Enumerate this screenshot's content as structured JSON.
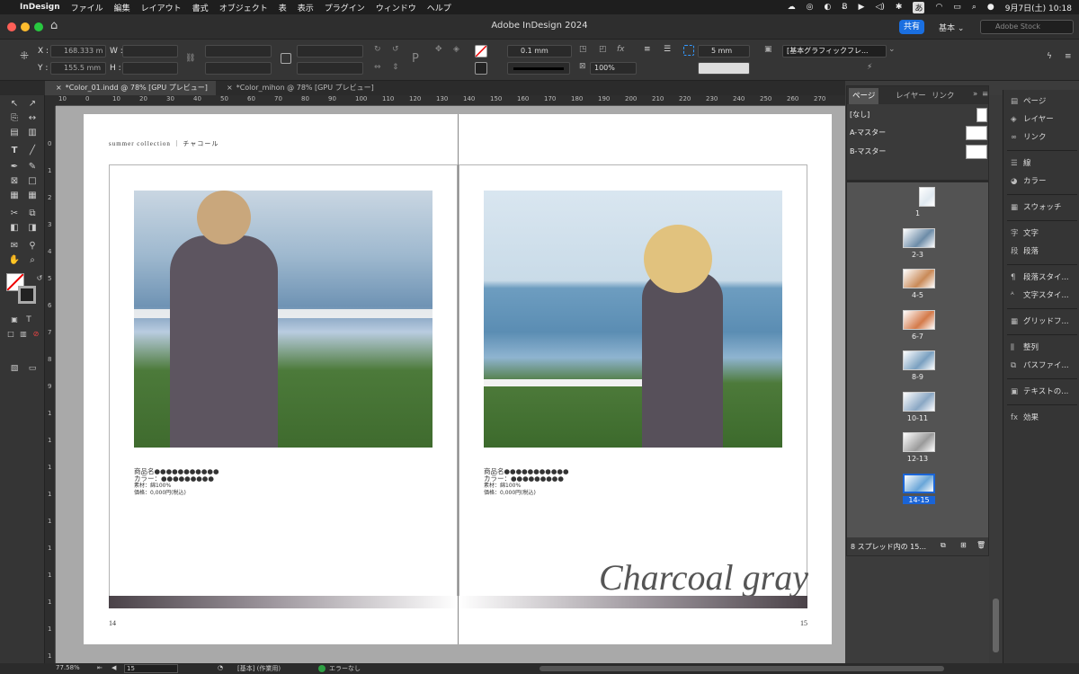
{
  "menubar": {
    "app": "InDesign",
    "items": [
      "ファイル",
      "編集",
      "レイアウト",
      "書式",
      "オブジェクト",
      "表",
      "表示",
      "プラグイン",
      "ウィンドウ",
      "ヘルプ"
    ],
    "input_mode": "あ",
    "datetime": "9月7日(土)  10:18"
  },
  "window": {
    "title": "Adobe InDesign 2024",
    "share_label": "共有",
    "workspace": "基本",
    "stock_placeholder": "Adobe Stock"
  },
  "control": {
    "x_label": "X :",
    "x_value": "168.333 m",
    "y_label": "Y :",
    "y_value": "155.5 mm",
    "w_label": "W :",
    "h_label": "H :",
    "stroke_weight": "0.1 mm",
    "opacity": "100%",
    "gap": "5 mm",
    "object_style": "[基本グラフィックフレ..."
  },
  "tabs": [
    {
      "label": "*Color_01.indd @ 78% [GPU プレビュー]",
      "active": true
    },
    {
      "label": "*Color_mihon @ 78% [GPU プレビュー]",
      "active": false
    }
  ],
  "ruler": {
    "h_ticks": [
      "10",
      "0",
      "10",
      "20",
      "30",
      "40",
      "50",
      "60",
      "70",
      "80",
      "90",
      "100",
      "110",
      "120",
      "130",
      "140",
      "150",
      "160",
      "170",
      "180",
      "190",
      "200",
      "210",
      "220",
      "230",
      "240",
      "250",
      "260",
      "270"
    ],
    "v_ticks": [
      "0",
      "1",
      "2",
      "3",
      "4",
      "5",
      "6",
      "7",
      "8",
      "9",
      "1",
      "1",
      "1",
      "1",
      "1",
      "1",
      "1",
      "1",
      "1",
      "1"
    ]
  },
  "document": {
    "header": "summer collection ｜ チャコール",
    "left_spec": {
      "name": "商品名●●●●●●●●●●●",
      "color": "カラー：●●●●●●●●●",
      "material": "素材：綿100%",
      "price": "価格：0,000円(税込)"
    },
    "right_spec": {
      "name": "商品名●●●●●●●●●●●",
      "color": "カラー：●●●●●●●●●",
      "material": "素材：綿100%",
      "price": "価格：0,000円(税込)"
    },
    "title": "Charcoal gray",
    "folio_left": "14",
    "folio_right": "15"
  },
  "pages_panel": {
    "tabs": [
      "ページ",
      "レイヤー",
      "リンク"
    ],
    "masters": [
      "[なし]",
      "A-マスター",
      "B-マスター"
    ],
    "spreads": [
      "1",
      "2-3",
      "4-5",
      "6-7",
      "8-9",
      "10-11",
      "12-13",
      "14-15"
    ],
    "footer": "8 スプレッド内の 15..."
  },
  "dock": {
    "items": [
      {
        "label": "ページ",
        "icon": "pages-icon"
      },
      {
        "label": "レイヤー",
        "icon": "layers-icon"
      },
      {
        "label": "リンク",
        "icon": "links-icon"
      },
      {
        "label": "線",
        "icon": "stroke-icon"
      },
      {
        "label": "カラー",
        "icon": "color-icon"
      },
      {
        "label": "スウォッチ",
        "icon": "swatches-icon"
      },
      {
        "label": "文字",
        "icon": "character-icon"
      },
      {
        "label": "段落",
        "icon": "paragraph-icon"
      },
      {
        "label": "段落スタイ...",
        "icon": "paragraph-styles-icon"
      },
      {
        "label": "文字スタイ...",
        "icon": "character-styles-icon"
      },
      {
        "label": "グリッドフ...",
        "icon": "grid-format-icon"
      },
      {
        "label": "整列",
        "icon": "align-icon"
      },
      {
        "label": "パスファイ...",
        "icon": "pathfinder-icon"
      },
      {
        "label": "テキストの...",
        "icon": "text-wrap-icon"
      },
      {
        "label": "効果",
        "icon": "effects-icon"
      }
    ]
  },
  "status": {
    "zoom": "77.58%",
    "page": "15",
    "profile": "[基本] (作業用)",
    "preflight": "エラーなし"
  },
  "colors": {
    "accent": "#1a6fe0",
    "selected_spread": "#1a64d6",
    "ok_green": "#2ea043"
  }
}
